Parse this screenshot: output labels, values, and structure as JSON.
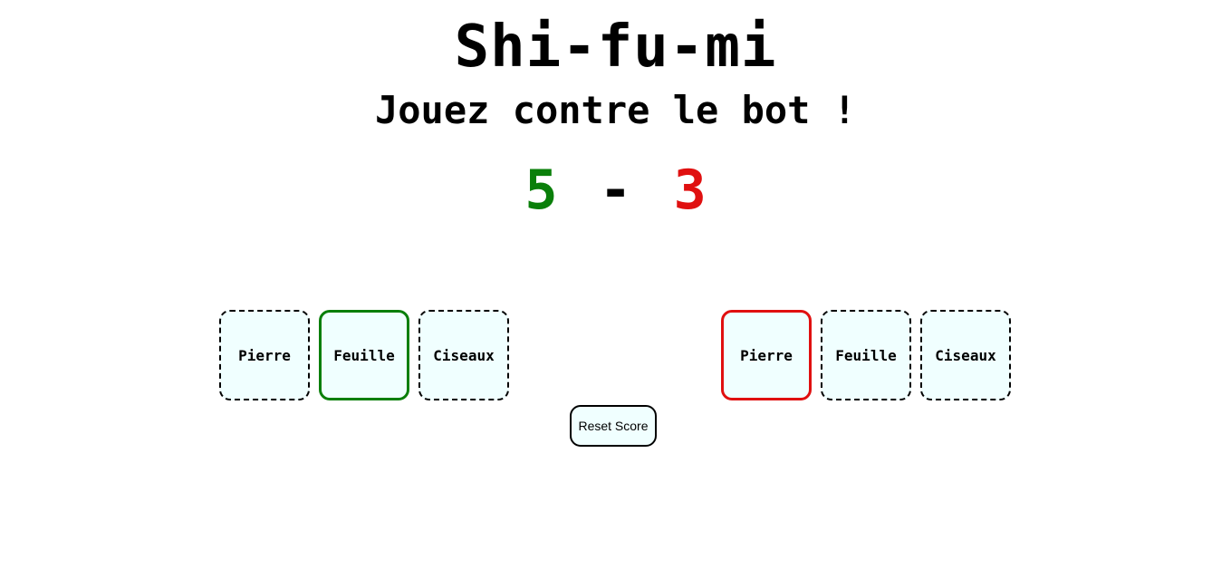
{
  "header": {
    "title": "Shi-fu-mi",
    "subtitle": "Jouez contre le bot !"
  },
  "score": {
    "player": "5",
    "separator": "-",
    "bot": "3",
    "player_color": "#0a7f0a",
    "bot_color": "#e01010"
  },
  "player_choices": [
    {
      "label": "Pierre",
      "state": "default"
    },
    {
      "label": "Feuille",
      "state": "selected-win"
    },
    {
      "label": "Ciseaux",
      "state": "default"
    }
  ],
  "bot_choices": [
    {
      "label": "Pierre",
      "state": "selected-lose"
    },
    {
      "label": "Feuille",
      "state": "default"
    },
    {
      "label": "Ciseaux",
      "state": "default"
    }
  ],
  "controls": {
    "reset_label": "Reset Score"
  }
}
